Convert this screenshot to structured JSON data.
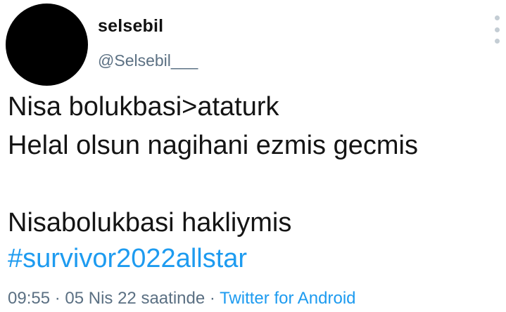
{
  "author": {
    "display_name": "selsebil",
    "handle": "@Selsebil___"
  },
  "tweet": {
    "lines": [
      "Nisa bolukbasi>ataturk",
      "Helal olsun nagihani ezmis gecmis",
      "Nisabolukbasi hakliymis"
    ],
    "hashtag": "#survivor2022allstar"
  },
  "meta": {
    "time": "09:55",
    "separator": " · ",
    "date": "05 Nis 22 saatinde",
    "source": "Twitter for Android"
  },
  "icons": {
    "more": "more-vertical-icon"
  },
  "colors": {
    "link": "#1d9bf0",
    "secondary_text": "#5b7083",
    "avatar": "#000000"
  }
}
